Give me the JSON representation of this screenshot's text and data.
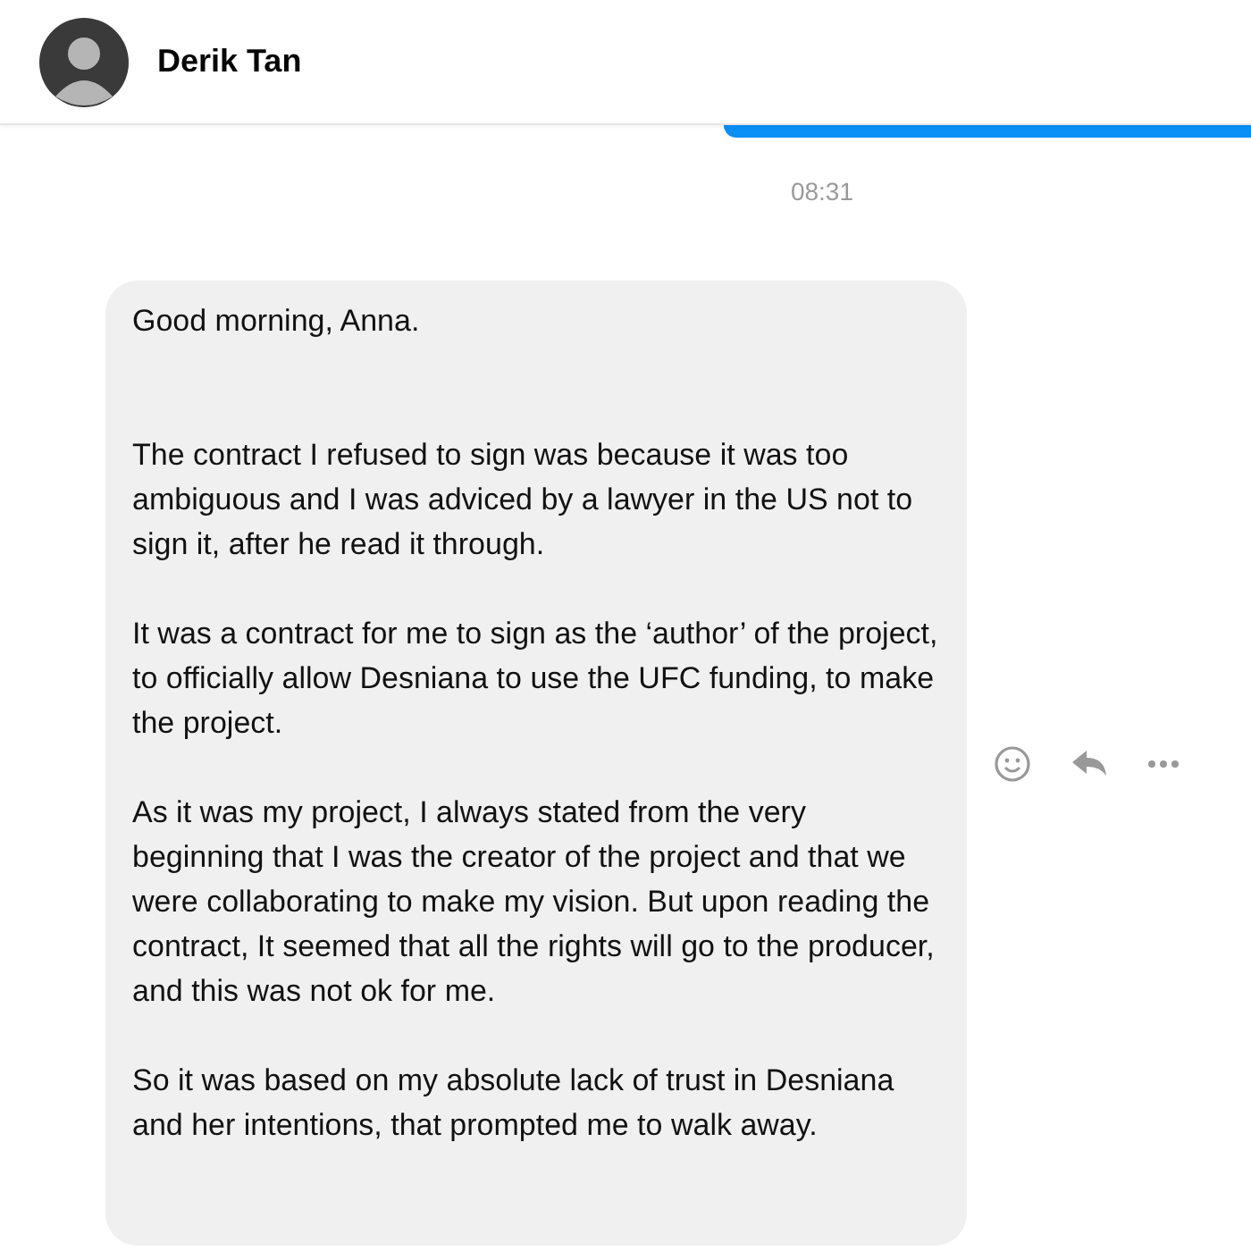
{
  "header": {
    "contact_name": "Derik Tan"
  },
  "timestamp": "08:31",
  "message": {
    "paragraphs": [
      "Good morning, Anna.",
      "The contract I refused to sign was because it was too ambiguous and I was adviced by a lawyer in the US not to sign it, after he read it through.",
      "It was a contract for me to sign as the ‘author’ of the project, to officially allow Desniana to use the UFC funding, to make the project.",
      "As it was my project, I always stated from the very beginning that I was the creator of the project and that we were collaborating to make my vision. But upon reading the contract, It seemed that all the rights will go to the producer, and this was not ok for me.",
      "So it was based on my absolute lack of trust in Desniana and her intentions, that prompted me to walk away."
    ]
  }
}
